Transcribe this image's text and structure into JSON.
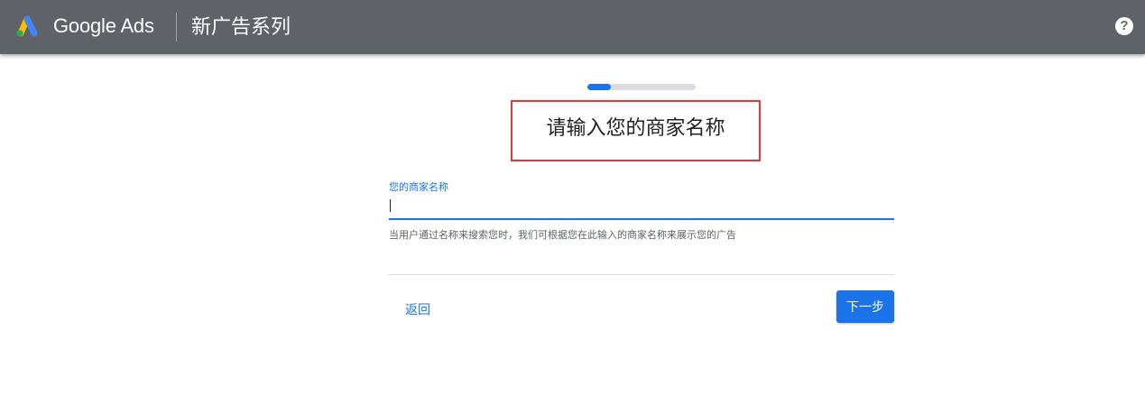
{
  "header": {
    "brand": "Google Ads",
    "page_title": "新广告系列",
    "help_glyph": "?"
  },
  "progress": {
    "fraction": 0.22
  },
  "main": {
    "heading": "请输入您的商家名称",
    "field": {
      "label": "您的商家名称",
      "value": "",
      "hint": "当用户通过名称来搜索您时，我们可根据您在此输入的商家名称来展示您的广告"
    },
    "back_label": "返回",
    "next_label": "下一步"
  },
  "colors": {
    "topbar": "#5f6368",
    "accent": "#1a73e8",
    "highlight_box": "#e53935",
    "logo_blue": "#4285f4",
    "logo_yellow": "#fbbc04",
    "logo_green": "#34a853"
  }
}
